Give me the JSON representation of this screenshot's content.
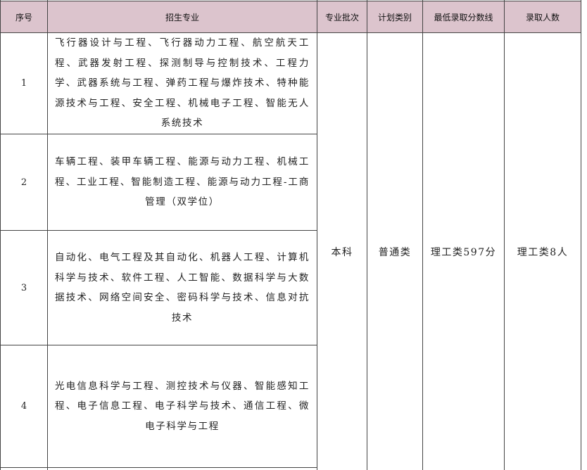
{
  "headers": {
    "index": "序号",
    "major": "招生专业",
    "batch": "专业批次",
    "plan_type": "计划类别",
    "min_score": "最低录取分数线",
    "admitted": "录取人数"
  },
  "rows": [
    {
      "index": "1",
      "majors": "飞行器设计与工程、飞行器动力工程、航空航天工程、武器发射工程、探测制导与控制技术、工程力学、武器系统与工程、弹药工程与爆炸技术、特种能源技术与工程、安全工程、机械电子工程、智能无人系统技术"
    },
    {
      "index": "2",
      "majors": "车辆工程、装甲车辆工程、能源与动力工程、机械工程、工业工程、智能制造工程、能源与动力工程-工商管理（双学位）"
    },
    {
      "index": "3",
      "majors": "自动化、电气工程及其自动化、机器人工程、计算机科学与技术、软件工程、人工智能、数据科学与大数据技术、网络空间安全、密码科学与技术、信息对抗技术"
    },
    {
      "index": "4",
      "majors": "光电信息科学与工程、测控技术与仪器、智能感知工程、电子信息工程、电子科学与技术、通信工程、微电子科学与工程"
    }
  ],
  "merged": {
    "batch": "本科",
    "plan_type": "普通类",
    "min_score": "理工类597分",
    "admitted": "理工类8人"
  },
  "colors": {
    "header_bg": "#dcc4cd",
    "border": "#444444"
  }
}
